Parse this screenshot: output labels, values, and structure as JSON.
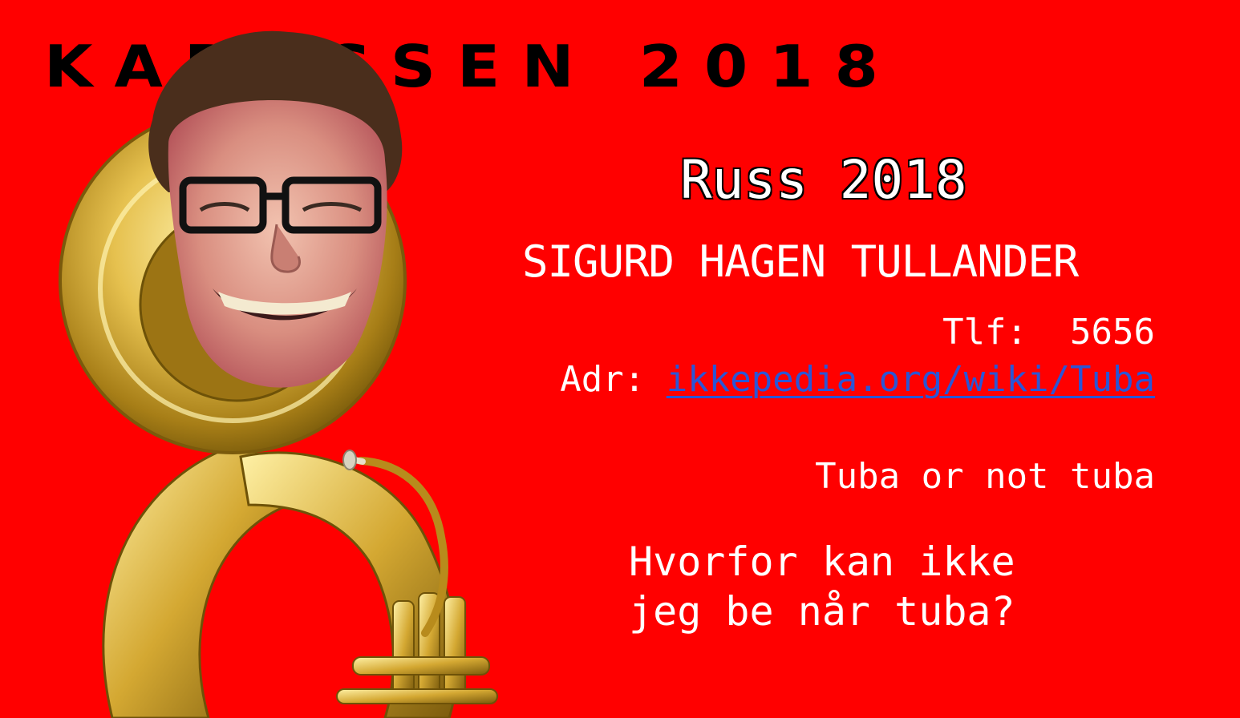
{
  "banner": {
    "text": "KARUSSEN 2018"
  },
  "card": {
    "title": "Russ 2018",
    "name": "SIGURD HAGEN TULLANDER",
    "phone_label": "Tlf:",
    "phone_value": "5656",
    "address_label": "Adr:",
    "address_link": "ikkepedia.org/wiki/Tuba",
    "tagline": "Tuba or not tuba",
    "question_line1": "Hvorfor kan ikke",
    "question_line2": "jeg be når tuba?"
  },
  "colors": {
    "background": "#ff0000",
    "banner_text": "#000000",
    "text": "#ffffff",
    "link": "#2a56d6",
    "brass": "#d9b23a"
  },
  "illustration": {
    "subject": "person-face-in-sousaphone",
    "icons": [
      "face-photo",
      "sousaphone-icon"
    ]
  }
}
